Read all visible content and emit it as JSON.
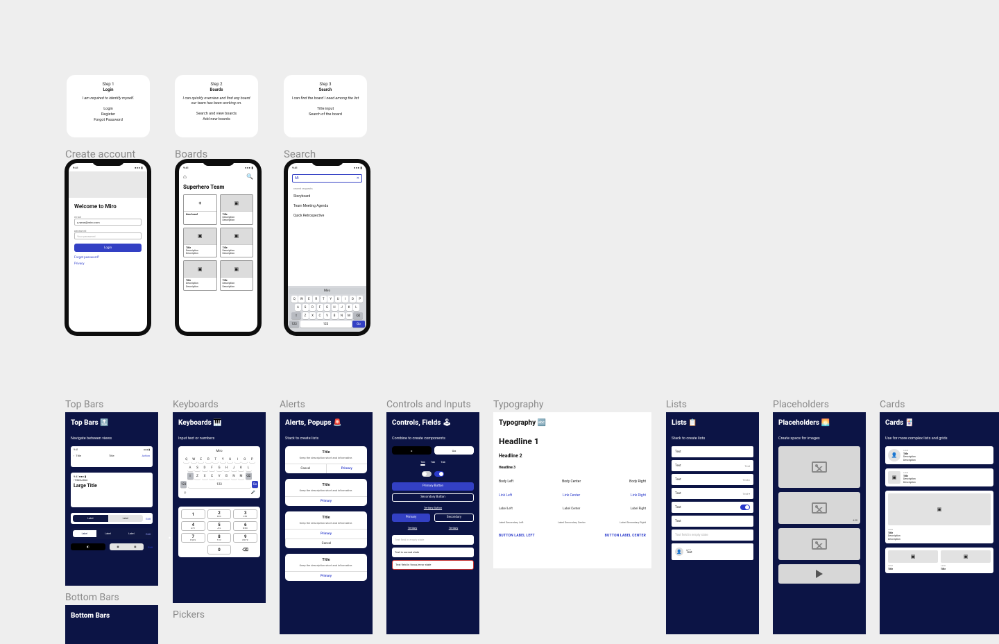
{
  "steps": [
    {
      "no": "Step 1",
      "title": "Login",
      "desc": "I am required to identify myself.",
      "bullets": [
        "Login",
        "Register",
        "Forgot Password"
      ]
    },
    {
      "no": "Step 2",
      "title": "Boards",
      "desc": "I can quickly overview and find any board our team has been working on.",
      "bullets": [
        "Search and view boards",
        "Add new boards"
      ]
    },
    {
      "no": "Step 3",
      "title": "Search",
      "desc": "I can find the board I need among the list",
      "bullets": [
        "Title input",
        "Search of the board"
      ]
    }
  ],
  "labels": {
    "create": "Create account",
    "boards": "Boards",
    "search": "Search",
    "topbars": "Top Bars",
    "keyboards": "Keyboards",
    "alerts": "Alerts",
    "controls": "Controls and Inputs",
    "typography": "Typography",
    "lists": "Lists",
    "placeholders": "Placeholders",
    "cards": "Cards",
    "bottombars": "Bottom Bars",
    "pickers": "Pickers"
  },
  "status_time": "9:41",
  "login": {
    "welcome": "Welcome to Miro",
    "email_label": "email",
    "email_value": "q.wran@miro.com",
    "pw_label": "password",
    "pw_value": "Your password",
    "button": "Login",
    "forgot": "Forgot password?",
    "privacy": "Privacy"
  },
  "boards": {
    "team": "Superhero Team",
    "new": "New board",
    "card": {
      "title": "Title",
      "d1": "Description",
      "d2": "Description"
    }
  },
  "searchp": {
    "cursor": "Mi",
    "close": "✕",
    "recent": "recent requests",
    "items": [
      "Storyboard",
      "Team Meeting Agenda",
      "Quick Retrospective"
    ],
    "sugg": "Miro",
    "go": "Go"
  },
  "qwerty": {
    "r1": [
      "Q",
      "W",
      "E",
      "R",
      "T",
      "Y",
      "U",
      "I",
      "O",
      "P"
    ],
    "r2": [
      "A",
      "S",
      "D",
      "F",
      "G",
      "H",
      "J",
      "K",
      "L"
    ],
    "r3_shift": "⇧",
    "r3": [
      "Z",
      "X",
      "C",
      "V",
      "B",
      "N",
      "M"
    ],
    "r3_del": "⌫",
    "r4_123": "123",
    "r4_emoji": "☺",
    "r4_space": "123",
    "r4_go": "Go"
  },
  "panels": {
    "topbars": {
      "title": "Top Bars 🔝",
      "sub": "Navigate between views",
      "title_txt": "Title",
      "action": "Action",
      "large": "Large Title",
      "seg_label": "Label",
      "seg_edit": "Edit"
    },
    "keyboards": {
      "title": "Keyboards 🎹",
      "sub": "Input text or numbers",
      "sugg": "Miro",
      "num_letters": [
        "",
        "ABC",
        "DEF",
        "GHI",
        "JKL",
        "MNO",
        "PQRS",
        "TUV",
        "WXYZ"
      ]
    },
    "alerts": {
      "title": "Alerts, Popups 🚨",
      "sub": "Stack to create lists",
      "atitle": "Title",
      "adesc": "Keep the description short and informative.",
      "cancel": "Cancel",
      "primary": "Primary"
    },
    "controls": {
      "title": "Controls, Fields 🕹",
      "sub": "Combine to create components",
      "tab": "Tab",
      "primary": "Primary Button",
      "secondary": "Secondary Button",
      "tertiary": "Tertiary Button",
      "prim": "Primary",
      "sec": "Secondary",
      "ter": "Tertiary",
      "ph": "Text field in empty state",
      "norm": "Text in normal state",
      "err": "Text field in focus/error state"
    },
    "typography": {
      "title": "Typography 🔤",
      "h1": "Headline 1",
      "h2": "Headline 2",
      "h3": "Headline 3",
      "body": [
        "Body Left",
        "Body Center",
        "Body Right"
      ],
      "link": [
        "Link Left",
        "Link Center",
        "Link Right"
      ],
      "lbl": [
        "Label Left",
        "Label Center",
        "Label Right"
      ],
      "sm": [
        "Label Secondary Left",
        "Label Secondary Center",
        "Label Secondary Right"
      ],
      "btn": [
        "BUTTON LABEL LEFT",
        "BUTTON LABEL CENTER"
      ]
    },
    "lists": {
      "title": "Lists 📋",
      "sub": "Stack to create lists",
      "text": "Text",
      "label": "Label",
      "empty": "Text field in empty state"
    },
    "placeholders": {
      "title": "Placeholders 🌅",
      "sub": "Create space for images",
      "dur": "4:20"
    },
    "cards": {
      "title": "Cards 🃏",
      "sub": "Use for more complex lists and grids",
      "label": "Label",
      "t": "Title",
      "d": "Description"
    }
  }
}
